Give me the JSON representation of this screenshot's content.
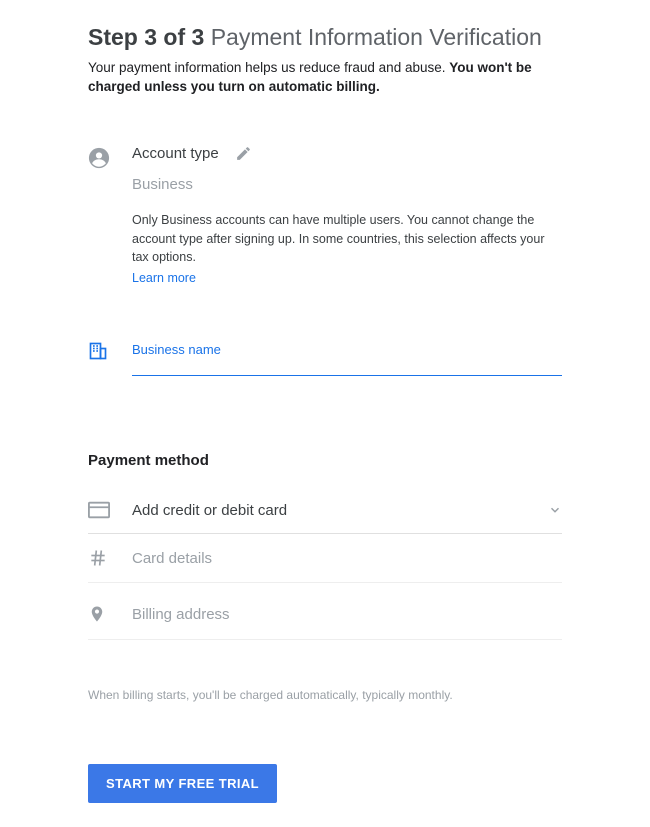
{
  "header": {
    "step_prefix": "Step 3 of 3",
    "title_rest": " Payment Information Verification",
    "sub_a": "Your payment information helps us reduce fraud and abuse. ",
    "sub_b": "You won't be charged unless you turn on automatic billing."
  },
  "account": {
    "label": "Account type",
    "value": "Business",
    "description": "Only Business accounts can have multiple users. You cannot change the account type after signing up. In some countries, this selection affects your tax options.",
    "learn_more": "Learn more"
  },
  "business_name": {
    "label": "Business name"
  },
  "payment_method": {
    "heading": "Payment method",
    "add_card_label": "Add credit or debit card",
    "card_details_placeholder": "Card details",
    "billing_address_placeholder": "Billing address"
  },
  "footnote": "When billing starts, you'll be charged automatically, typically monthly.",
  "cta": "START MY FREE TRIAL"
}
